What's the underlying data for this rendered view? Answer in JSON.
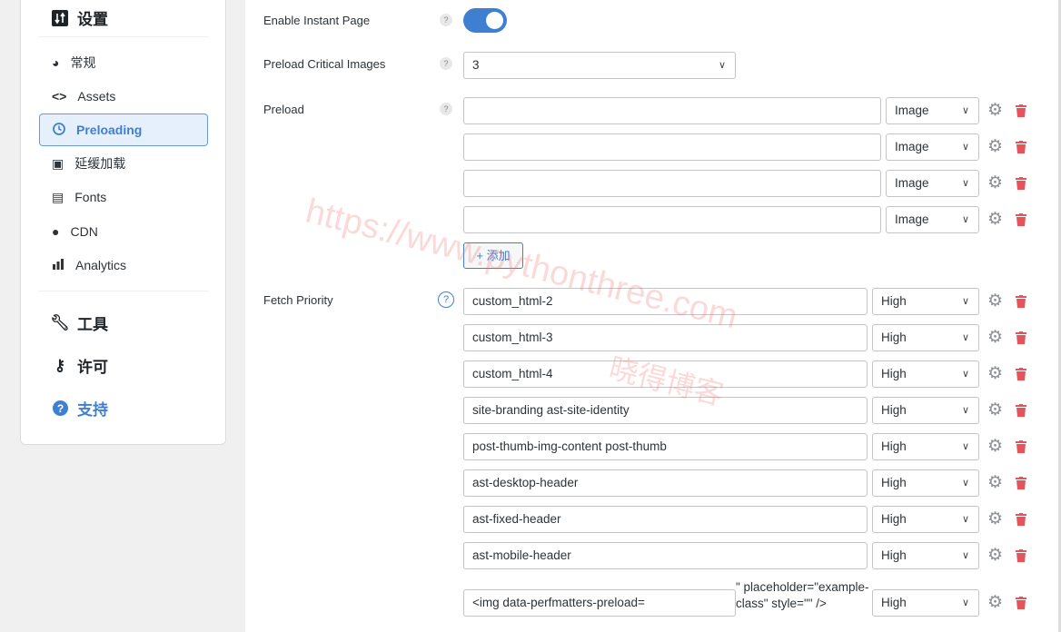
{
  "sidebar": {
    "settings_title": "设置",
    "items": [
      {
        "label": "常规",
        "icon": "dashboard-icon"
      },
      {
        "label": "Assets",
        "icon": "code-icon"
      },
      {
        "label": "Preloading",
        "icon": "clock-icon",
        "active": true
      },
      {
        "label": "延缓加载",
        "icon": "images-icon"
      },
      {
        "label": "Fonts",
        "icon": "font-icon"
      },
      {
        "label": "CDN",
        "icon": "globe-icon"
      },
      {
        "label": "Analytics",
        "icon": "bar-chart-icon"
      }
    ],
    "tools": "工具",
    "license": "许可",
    "support": "支持"
  },
  "main": {
    "instant_page": {
      "label": "Enable Instant Page",
      "enabled": true
    },
    "critical_images": {
      "label": "Preload Critical Images",
      "value": "3"
    },
    "preload": {
      "label": "Preload",
      "rows": [
        {
          "value": "",
          "type": "Image"
        },
        {
          "value": "",
          "type": "Image"
        },
        {
          "value": "",
          "type": "Image"
        },
        {
          "value": "",
          "type": "Image"
        }
      ],
      "add_label": "+ 添加"
    },
    "fetch_priority": {
      "label": "Fetch Priority",
      "rows": [
        {
          "value": "custom_html-2",
          "priority": "High"
        },
        {
          "value": "custom_html-3",
          "priority": "High"
        },
        {
          "value": "custom_html-4",
          "priority": "High"
        },
        {
          "value": "site-branding ast-site-identity",
          "priority": "High"
        },
        {
          "value": "post-thumb-img-content post-thumb",
          "priority": "High"
        },
        {
          "value": "ast-desktop-header",
          "priority": "High"
        },
        {
          "value": "ast-fixed-header",
          "priority": "High"
        },
        {
          "value": "ast-mobile-header",
          "priority": "High"
        }
      ],
      "last_row": {
        "value": "<img data-perfmatters-preload=",
        "overflow": "\" placeholder=\"example-class\" style=\"\" />",
        "priority": "High"
      }
    },
    "help": "?"
  },
  "watermark": {
    "url": "https://www.pythonthree.com",
    "name": "晓得博客"
  },
  "colors": {
    "accent": "#3f7fd2",
    "danger": "#e5545a"
  }
}
